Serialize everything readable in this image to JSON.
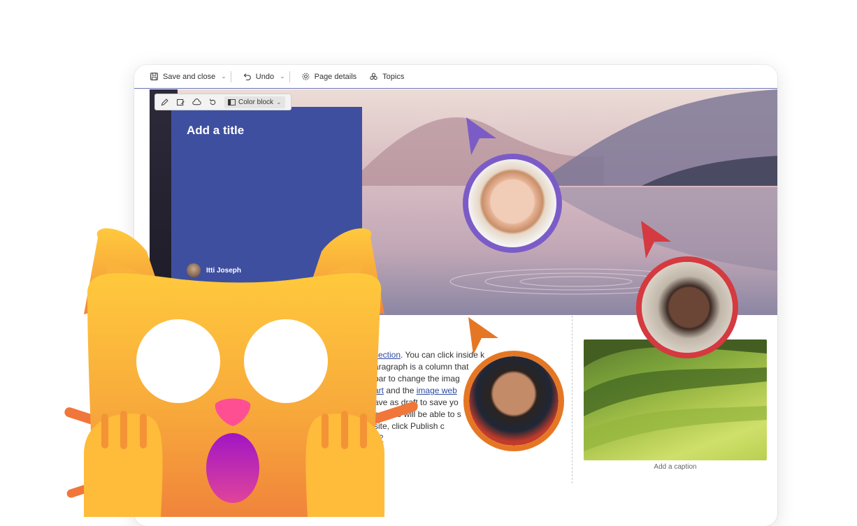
{
  "toolbar": {
    "save_close": "Save and close",
    "undo": "Undo",
    "page_details": "Page details",
    "topics": "Topics"
  },
  "edit_toolbar": {
    "color_block": "Color block"
  },
  "hero": {
    "title_placeholder": "Add a title",
    "author": "Itti Joseph"
  },
  "content": {
    "link_section": " section",
    "t1": ". You can click inside ",
    "t1b": "k",
    "t2": "aragraph is a column that",
    "t3": "bar to change the imag",
    "link_art": "art",
    "t4": " and the ",
    "link_imageweb": "image web",
    "t5": "ave as draft to save yo",
    "t6": "our site will be able to s",
    "t7": " site, click Publish c",
    "link_end": "n?",
    "caption": "Add a caption"
  },
  "colors": {
    "accent": "#3f4fa0",
    "purple": "#7b5cc7",
    "red": "#d43a3f",
    "orange": "#e57724",
    "cat": "#f7b437"
  },
  "icons": [
    "save-icon",
    "undo-icon",
    "gear-icon",
    "topics-icon",
    "pencil-icon",
    "image-edit-icon",
    "cloud-icon",
    "rotate-icon",
    "color-block-icon"
  ]
}
